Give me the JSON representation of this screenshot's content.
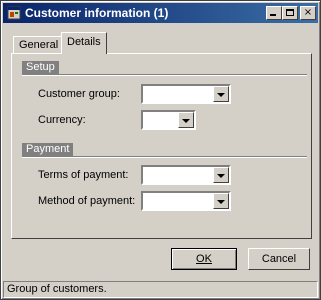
{
  "window": {
    "title": "Customer information (1)",
    "icon": "app-window-icon",
    "controls": {
      "minimize": "minimize-icon",
      "maximize": "maximize-icon",
      "close": "×"
    }
  },
  "tabs": [
    {
      "label": "General",
      "selected": false
    },
    {
      "label": "Details",
      "selected": true
    }
  ],
  "groups": {
    "setup": {
      "title": "Setup",
      "fields": [
        {
          "label": "Customer group:",
          "value": ""
        },
        {
          "label": "Currency:",
          "value": ""
        }
      ]
    },
    "payment": {
      "title": "Payment",
      "fields": [
        {
          "label": "Terms of payment:",
          "value": ""
        },
        {
          "label": "Method of payment:",
          "value": ""
        }
      ]
    }
  },
  "buttons": {
    "ok": "OK",
    "cancel": "Cancel"
  },
  "status": "Group of customers.",
  "colors": {
    "titlebar_start": "#0a246a",
    "titlebar_end": "#3a6ea5",
    "face": "#d4d0c8"
  }
}
